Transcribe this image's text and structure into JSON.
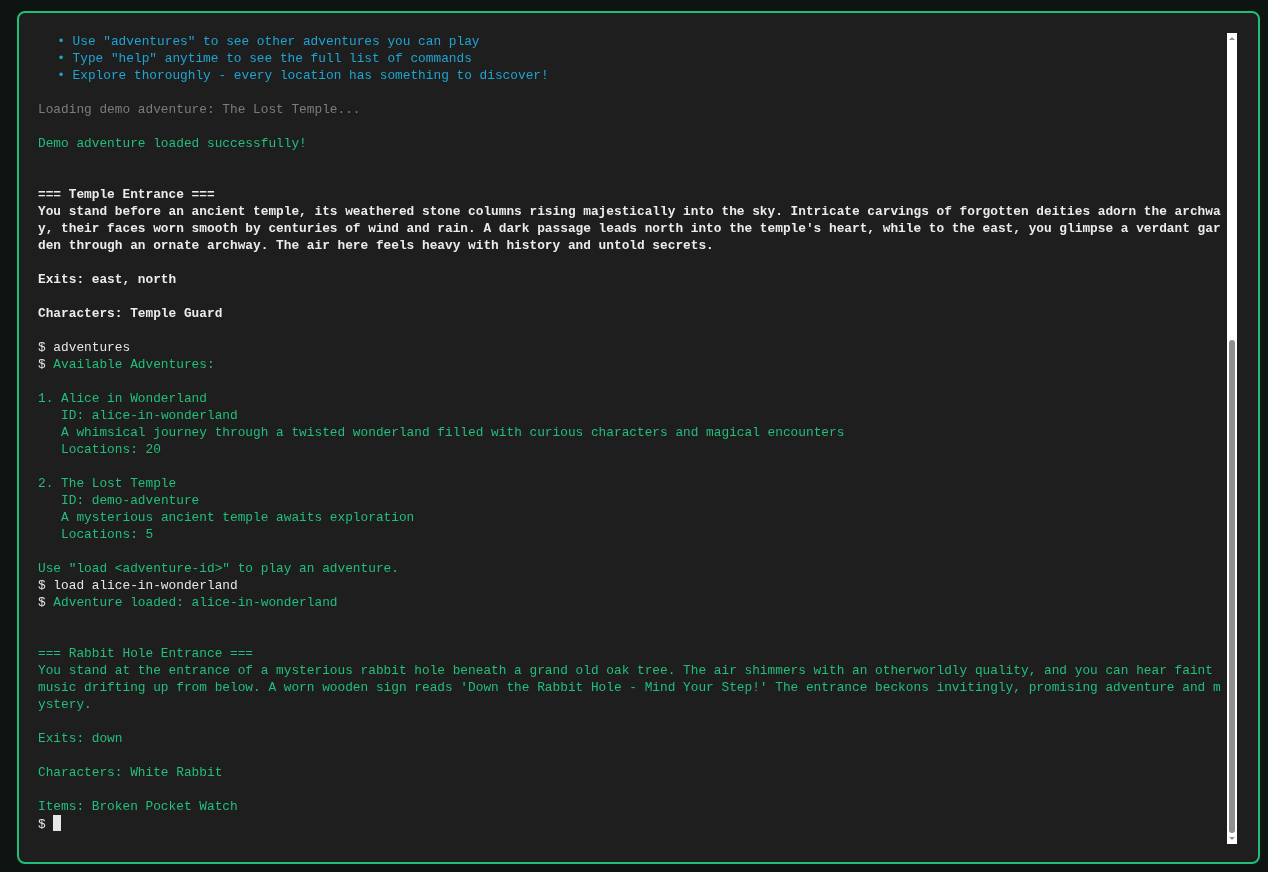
{
  "terminal": {
    "blocks": [
      {
        "kind": "normal",
        "lines": [
          {
            "kind": "bullet",
            "marker": "•",
            "text": "Use \"adventures\" to see other adventures you can play"
          },
          {
            "kind": "bullet",
            "marker": "•",
            "text": "Type \"help\" anytime to see the full list of commands"
          },
          {
            "kind": "bullet",
            "marker": "•",
            "text": "Explore thoroughly - every location has something to discover!"
          }
        ]
      },
      {
        "kind": "normal",
        "lines": [
          {
            "kind": "muted",
            "text": "Loading demo adventure: The Lost Temple..."
          }
        ]
      },
      {
        "kind": "wide",
        "lines": [
          {
            "kind": "success",
            "text": "Demo adventure loaded successfully!"
          }
        ]
      },
      {
        "kind": "normal",
        "lines": [
          {
            "kind": "strong",
            "text": "=== Temple Entrance ==="
          },
          {
            "kind": "strong",
            "text": "You stand before an ancient temple, its weathered stone columns rising majestically into the sky. Intricate carvings of forgotten deities adorn the archway, their faces worn smooth by centuries of wind and rain. A dark passage leads north into the temple's heart, while to the east, you glimpse a verdant garden through an ornate archway. The air here feels heavy with history and untold secrets."
          }
        ]
      },
      {
        "kind": "normal",
        "lines": [
          {
            "kind": "strong",
            "text": "Exits: east, north"
          }
        ]
      },
      {
        "kind": "normal",
        "lines": [
          {
            "kind": "strong",
            "text": "Characters: Temple Guard"
          }
        ]
      },
      {
        "kind": "normal",
        "lines": [
          {
            "kind": "command",
            "prompt": "$",
            "text": "adventures"
          },
          {
            "kind": "response",
            "prompt": "$",
            "text": "Available Adventures:"
          }
        ]
      },
      {
        "kind": "normal",
        "lines": [
          {
            "kind": "success",
            "text": "1. Alice in Wonderland"
          },
          {
            "kind": "success",
            "text": "   ID: alice-in-wonderland"
          },
          {
            "kind": "success",
            "text": "   A whimsical journey through a twisted wonderland filled with curious characters and magical encounters"
          },
          {
            "kind": "success",
            "text": "   Locations: 20"
          }
        ]
      },
      {
        "kind": "normal",
        "lines": [
          {
            "kind": "success",
            "text": "2. The Lost Temple"
          },
          {
            "kind": "success",
            "text": "   ID: demo-adventure"
          },
          {
            "kind": "success",
            "text": "   A mysterious ancient temple awaits exploration"
          },
          {
            "kind": "success",
            "text": "   Locations: 5"
          }
        ]
      },
      {
        "kind": "wide",
        "lines": [
          {
            "kind": "success",
            "text": "Use \"load <adventure-id>\" to play an adventure."
          },
          {
            "kind": "command",
            "prompt": "$",
            "text": "load alice-in-wonderland"
          },
          {
            "kind": "response",
            "prompt": "$",
            "text": "Adventure loaded: alice-in-wonderland"
          }
        ]
      },
      {
        "kind": "normal",
        "lines": [
          {
            "kind": "success",
            "text": "=== Rabbit Hole Entrance ==="
          },
          {
            "kind": "success",
            "text": "You stand at the entrance of a mysterious rabbit hole beneath a grand old oak tree. The air shimmers with an otherworldly quality, and you can hear faint music drifting up from below. A worn wooden sign reads 'Down the Rabbit Hole - Mind Your Step!' The entrance beckons invitingly, promising adventure and mystery."
          }
        ]
      },
      {
        "kind": "normal",
        "lines": [
          {
            "kind": "success",
            "text": "Exits: down"
          }
        ]
      },
      {
        "kind": "normal",
        "lines": [
          {
            "kind": "success",
            "text": "Characters: White Rabbit"
          }
        ]
      },
      {
        "kind": "normal",
        "lines": [
          {
            "kind": "success",
            "text": "Items: Broken Pocket Watch"
          },
          {
            "kind": "input",
            "prompt": "$"
          }
        ]
      }
    ]
  }
}
